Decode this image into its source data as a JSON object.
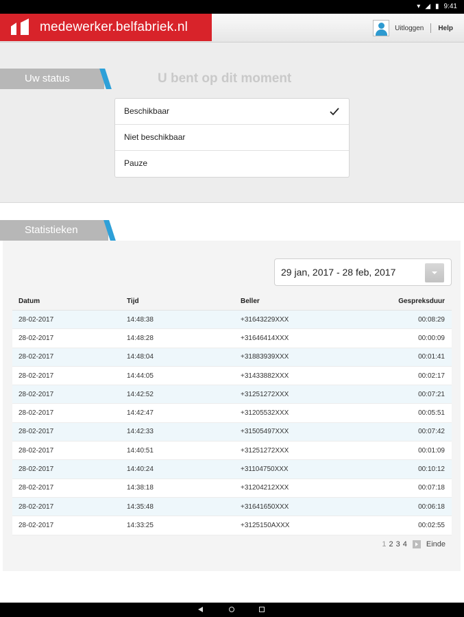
{
  "status_bar": {
    "time": "9:41"
  },
  "header": {
    "brand": "medewerker.belfabriek.nl",
    "logout_label": "Uitloggen",
    "help_label": "Help"
  },
  "status": {
    "tab_label": "Uw status",
    "question": "U bent op dit moment",
    "options": [
      {
        "label": "Beschikbaar",
        "selected": true
      },
      {
        "label": "Niet beschikbaar",
        "selected": false
      },
      {
        "label": "Pauze",
        "selected": false
      }
    ]
  },
  "stats": {
    "tab_label": "Statistieken",
    "date_range": "29 jan, 2017 - 28 feb, 2017",
    "columns": [
      "Datum",
      "Tijd",
      "Beller",
      "Gespreksduur"
    ],
    "rows": [
      [
        "28-02-2017",
        "14:48:38",
        "+31643229XXX",
        "00:08:29"
      ],
      [
        "28-02-2017",
        "14:48:28",
        "+31646414XXX",
        "00:00:09"
      ],
      [
        "28-02-2017",
        "14:48:04",
        "+31883939XXX",
        "00:01:41"
      ],
      [
        "28-02-2017",
        "14:44:05",
        "+31433882XXX",
        "00:02:17"
      ],
      [
        "28-02-2017",
        "14:42:52",
        "+31251272XXX",
        "00:07:21"
      ],
      [
        "28-02-2017",
        "14:42:47",
        "+31205532XXX",
        "00:05:51"
      ],
      [
        "28-02-2017",
        "14:42:33",
        "+31505497XXX",
        "00:07:42"
      ],
      [
        "28-02-2017",
        "14:40:51",
        "+31251272XXX",
        "00:01:09"
      ],
      [
        "28-02-2017",
        "14:40:24",
        "+31104750XXX",
        "00:10:12"
      ],
      [
        "28-02-2017",
        "14:38:18",
        "+31204212XXX",
        "00:07:18"
      ],
      [
        "28-02-2017",
        "14:35:48",
        "+31641650XXX",
        "00:06:18"
      ],
      [
        "28-02-2017",
        "14:33:25",
        "+3125150AXXX",
        "00:02:55"
      ]
    ],
    "pager": {
      "pages": [
        "1",
        "2",
        "3",
        "4"
      ],
      "current": "1",
      "end_label": "Einde"
    }
  },
  "colors": {
    "brand_red": "#d8232a",
    "accent_blue": "#2ea0d8",
    "row_alt": "#eef7fb"
  }
}
